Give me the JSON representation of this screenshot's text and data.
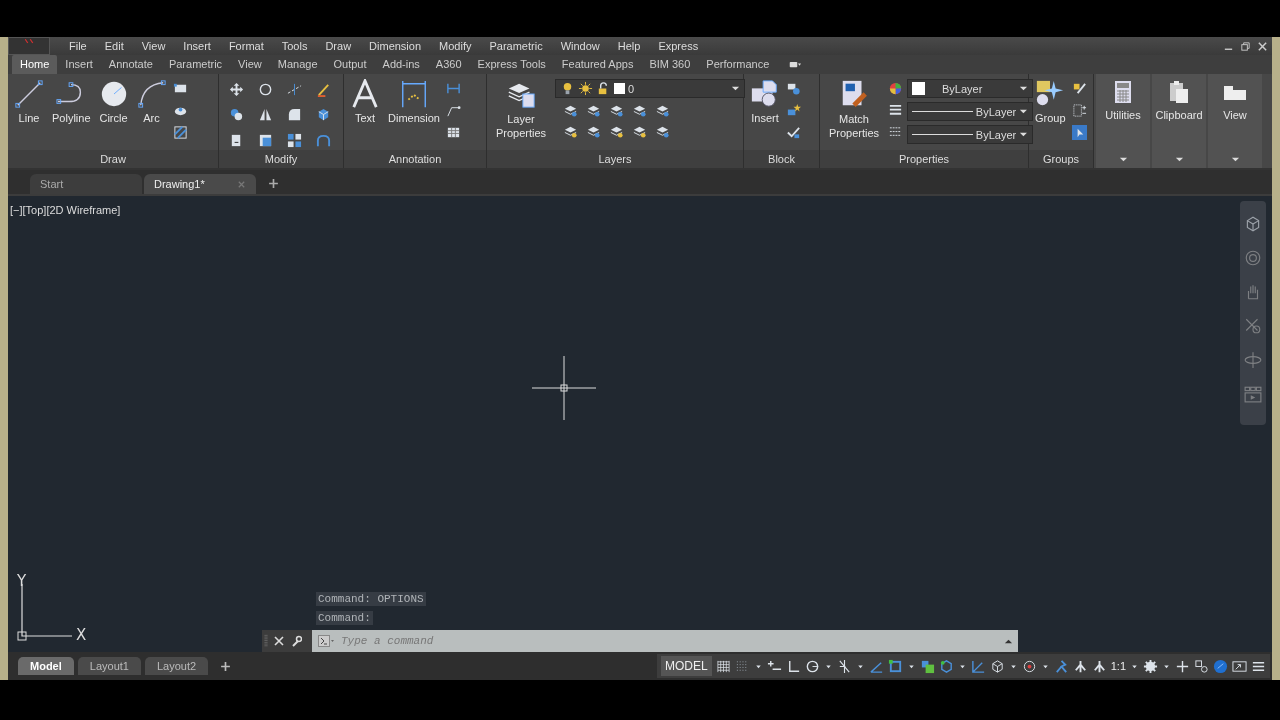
{
  "menu_bar": {
    "items": [
      "File",
      "Edit",
      "View",
      "Insert",
      "Format",
      "Tools",
      "Draw",
      "Dimension",
      "Modify",
      "Parametric",
      "Window",
      "Help",
      "Express"
    ]
  },
  "ribbon_tabs": [
    {
      "label": "Home",
      "selected": true
    },
    {
      "label": "Insert",
      "selected": false
    },
    {
      "label": "Annotate",
      "selected": false
    },
    {
      "label": "Parametric",
      "selected": false
    },
    {
      "label": "View",
      "selected": false
    },
    {
      "label": "Manage",
      "selected": false
    },
    {
      "label": "Output",
      "selected": false
    },
    {
      "label": "Add-ins",
      "selected": false
    },
    {
      "label": "A360",
      "selected": false
    },
    {
      "label": "Express Tools",
      "selected": false
    },
    {
      "label": "Featured Apps",
      "selected": false
    },
    {
      "label": "BIM 360",
      "selected": false
    },
    {
      "label": "Performance",
      "selected": false
    }
  ],
  "panels": {
    "draw": {
      "title": "Draw",
      "tools": [
        "Line",
        "Polyline",
        "Circle",
        "Arc"
      ]
    },
    "modify": {
      "title": "Modify"
    },
    "annotation": {
      "title": "Annotation",
      "tools": [
        "Text",
        "Dimension"
      ]
    },
    "layers": {
      "title": "Layers",
      "tool": "Layer Properties",
      "current_layer": "0"
    },
    "block": {
      "title": "Block",
      "tool": "Insert"
    },
    "properties": {
      "title": "Properties",
      "tool": "Match Properties",
      "color_setting": "ByLayer",
      "linetype": "ByLayer",
      "lineweight": "ByLayer"
    },
    "groups": {
      "title": "Groups",
      "tool": "Group"
    },
    "collapsed": [
      "Utilities",
      "Clipboard",
      "View"
    ]
  },
  "file_tabs": [
    {
      "label": "Start",
      "selected": false
    },
    {
      "label": "Drawing1*",
      "selected": true
    }
  ],
  "viewport_label": "[−][Top][2D Wireframe]",
  "ucs": {
    "x_label": "X",
    "y_label": "Y"
  },
  "command_history": [
    "Command: OPTIONS",
    "Command:"
  ],
  "command_line": {
    "placeholder": "Type a command"
  },
  "layout_tabs": [
    {
      "label": "Model",
      "selected": true
    },
    {
      "label": "Layout1",
      "selected": false
    },
    {
      "label": "Layout2",
      "selected": false
    }
  ],
  "status_bar": {
    "space": "MODEL",
    "scale": "1:1"
  }
}
